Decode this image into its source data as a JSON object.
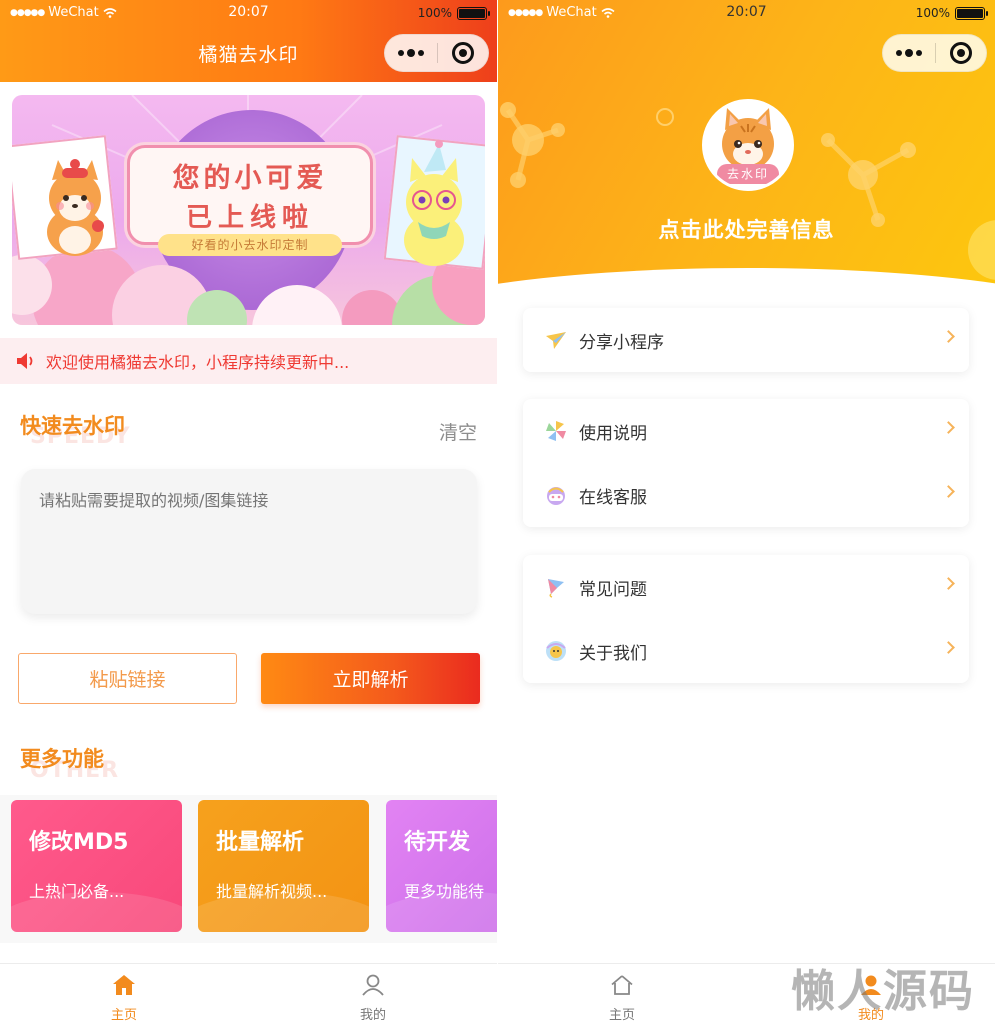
{
  "status_bar": {
    "carrier": "WeChat",
    "time": "20:07",
    "battery": "100%"
  },
  "left": {
    "nav_title": "橘猫去水印",
    "banner": {
      "line1": "您的小可爱",
      "line2": "已上线啦",
      "ribbon": "好看的小去水印定制"
    },
    "notice": "欢迎使用橘猫去水印，小程序持续更新中...",
    "quick": {
      "title": "快速去水印",
      "shadow": "SPEEDY",
      "clear": "清空",
      "placeholder": "请粘贴需要提取的视频/图集链接"
    },
    "buttons": {
      "paste": "粘贴链接",
      "parse": "立即解析"
    },
    "more": {
      "title": "更多功能",
      "shadow": "OTHER"
    },
    "features": [
      {
        "title": "修改MD5",
        "subtitle": "上热门必备..."
      },
      {
        "title": "批量解析",
        "subtitle": "批量解析视频..."
      },
      {
        "title": "待开发",
        "subtitle": "更多功能待"
      }
    ],
    "tabs": [
      {
        "label": "主页"
      },
      {
        "label": "我的"
      }
    ]
  },
  "right": {
    "avatar_tag": "去水印",
    "profile_prompt": "点击此处完善信息",
    "menu_groups": [
      [
        {
          "label": "分享小程序"
        }
      ],
      [
        {
          "label": "使用说明"
        },
        {
          "label": "在线客服"
        }
      ],
      [
        {
          "label": "常见问题"
        },
        {
          "label": "关于我们"
        }
      ]
    ],
    "tabs": [
      {
        "label": "主页"
      },
      {
        "label": "我的"
      }
    ]
  },
  "watermark": "懒人源码",
  "colors": {
    "accent": "#f28b1e",
    "primary_gradient_start": "#ff8a13",
    "primary_gradient_end": "#ea2b1f",
    "notice_red": "#ef3a33",
    "arrow": "#f6b35a"
  }
}
